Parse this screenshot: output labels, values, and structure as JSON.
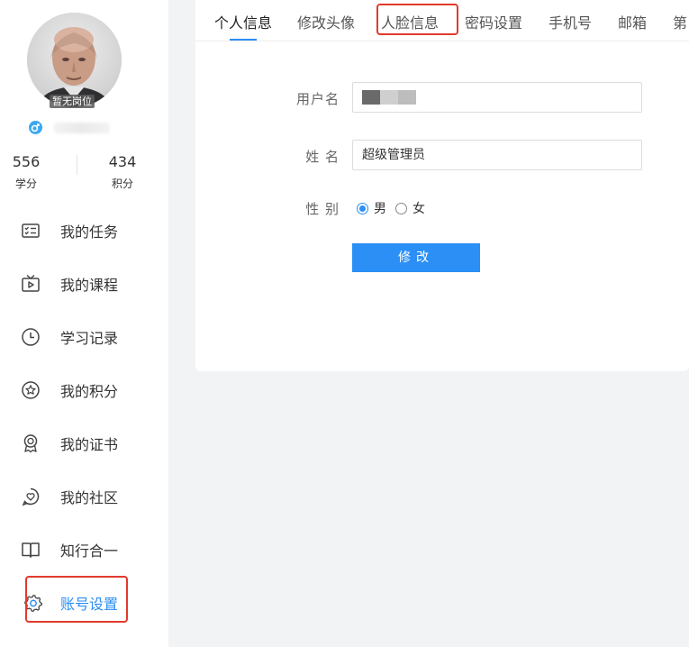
{
  "profile": {
    "post_badge": "暂无岗位",
    "stats": [
      {
        "value": "556",
        "label": "学分"
      },
      {
        "value": "434",
        "label": "积分"
      }
    ]
  },
  "sidebar": {
    "items": [
      {
        "label": "我的任务",
        "icon": "task-list-icon"
      },
      {
        "label": "我的课程",
        "icon": "tv-play-icon"
      },
      {
        "label": "学习记录",
        "icon": "clock-icon"
      },
      {
        "label": "我的积分",
        "icon": "star-circle-icon"
      },
      {
        "label": "我的证书",
        "icon": "award-icon"
      },
      {
        "label": "我的社区",
        "icon": "heart-chat-icon"
      },
      {
        "label": "知行合一",
        "icon": "book-icon"
      },
      {
        "label": "账号设置",
        "icon": "gear-icon",
        "active": true
      }
    ]
  },
  "tabs": [
    {
      "label": "个人信息",
      "active": true
    },
    {
      "label": "修改头像"
    },
    {
      "label": "人脸信息",
      "highlighted": true
    },
    {
      "label": "密码设置"
    },
    {
      "label": "手机号"
    },
    {
      "label": "邮箱"
    },
    {
      "label": "第"
    }
  ],
  "form": {
    "username_label": "用户名",
    "name_label": "姓 名",
    "name_value": "超级管理员",
    "gender_label": "性 别",
    "gender_options": [
      "男",
      "女"
    ],
    "gender_selected": "男",
    "submit_label": "修改"
  },
  "colors": {
    "accent": "#2b8ff5",
    "highlight": "#e23a2c"
  }
}
